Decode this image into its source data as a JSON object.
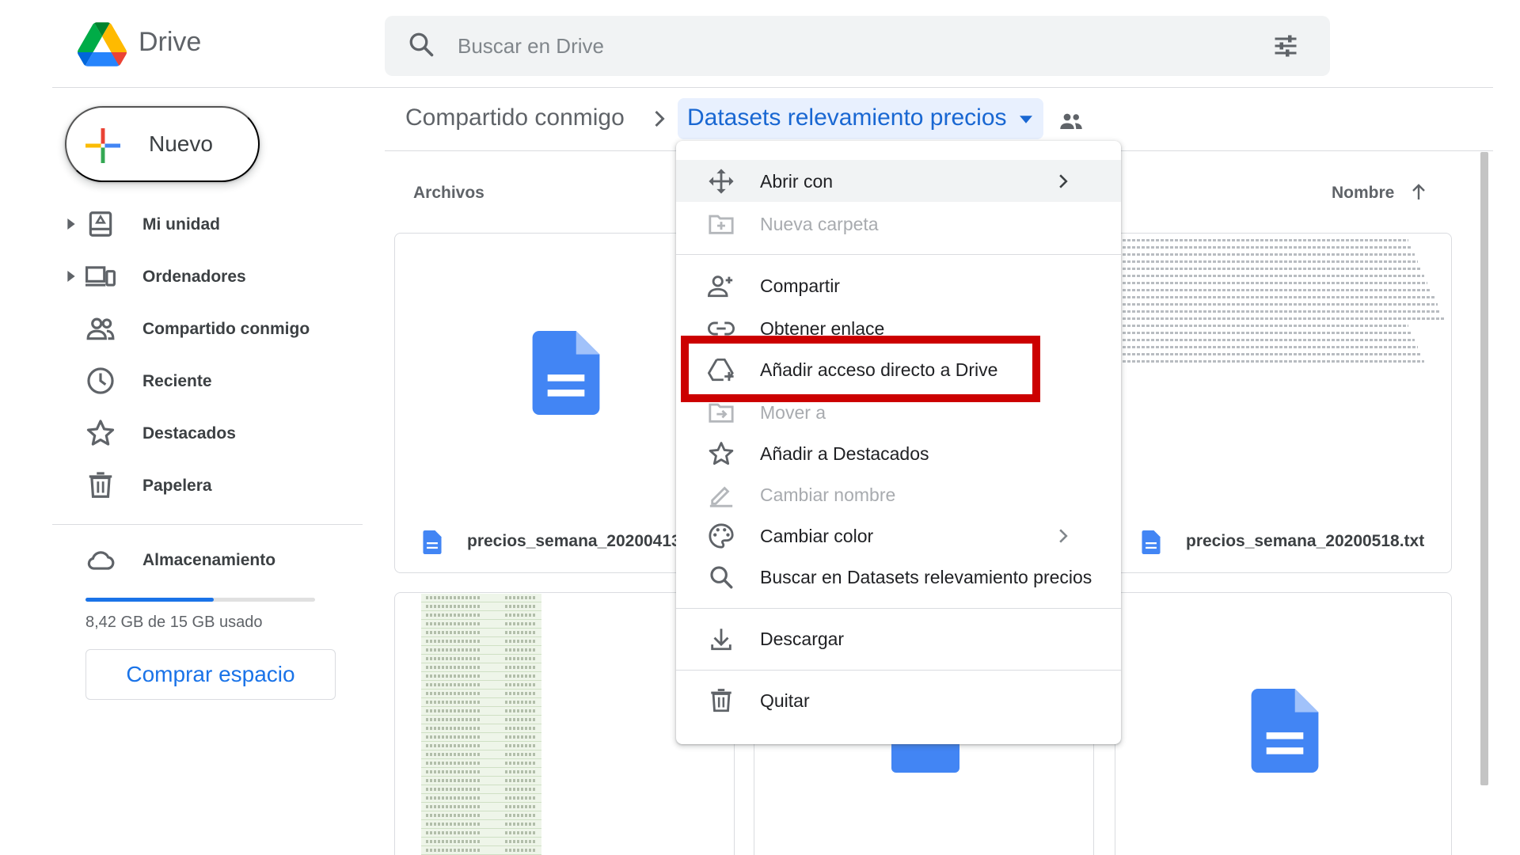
{
  "app": {
    "title": "Drive"
  },
  "search": {
    "placeholder": "Buscar en Drive"
  },
  "new_button": {
    "label": "Nuevo"
  },
  "sidebar": {
    "items": [
      {
        "label": "Mi unidad",
        "icon": "my-drive-icon"
      },
      {
        "label": "Ordenadores",
        "icon": "computers-icon"
      },
      {
        "label": "Compartido conmigo",
        "icon": "shared-icon"
      },
      {
        "label": "Reciente",
        "icon": "clock-icon"
      },
      {
        "label": "Destacados",
        "icon": "star-icon"
      },
      {
        "label": "Papelera",
        "icon": "trash-icon"
      }
    ],
    "storage": {
      "label": "Almacenamiento",
      "usage_text": "8,42 GB de 15 GB usado",
      "used_fraction": 0.56,
      "buy_label": "Comprar espacio"
    }
  },
  "breadcrumb": {
    "parent": "Compartido conmigo",
    "current": "Datasets relevamiento precios"
  },
  "content": {
    "section_label": "Archivos",
    "sort_label": "Nombre"
  },
  "files": [
    {
      "name": "precios_semana_20200413"
    },
    {
      "name": "precios_semana_20200518.txt"
    }
  ],
  "context_menu": {
    "items": [
      {
        "label": "Abrir con",
        "icon": "move-arrows-icon",
        "enabled": true,
        "submenu": true
      },
      {
        "label": "Nueva carpeta",
        "icon": "new-folder-icon",
        "enabled": false
      },
      {
        "label": "Compartir",
        "icon": "add-person-icon",
        "enabled": true
      },
      {
        "label": "Obtener enlace",
        "icon": "link-icon",
        "enabled": true
      },
      {
        "label": "Añadir acceso directo a Drive",
        "icon": "add-shortcut-icon",
        "enabled": true
      },
      {
        "label": "Mover a",
        "icon": "move-to-icon",
        "enabled": false
      },
      {
        "label": "Añadir a Destacados",
        "icon": "star-icon",
        "enabled": true
      },
      {
        "label": "Cambiar nombre",
        "icon": "pencil-icon",
        "enabled": false
      },
      {
        "label": "Cambiar color",
        "icon": "palette-icon",
        "enabled": true,
        "submenu": true
      },
      {
        "label": "Buscar en Datasets relevamiento precios",
        "icon": "search-icon",
        "enabled": true
      },
      {
        "label": "Descargar",
        "icon": "download-icon",
        "enabled": true
      },
      {
        "label": "Quitar",
        "icon": "trash-icon",
        "enabled": true
      }
    ],
    "highlighted_item": "Añadir acceso directo a Drive",
    "highlight_color": "#cc0000"
  },
  "colors": {
    "accent": "#1a73e8",
    "doc_blue": "#4285f4",
    "selected_bg": "#e8f0fe"
  }
}
